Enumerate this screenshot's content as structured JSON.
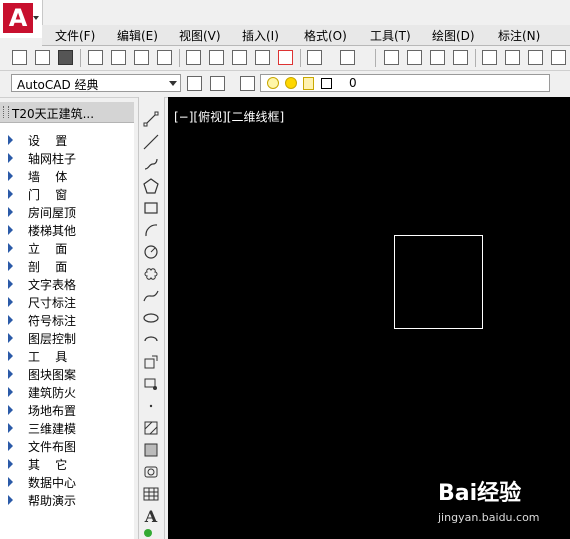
{
  "app": {
    "logo_letter": "A"
  },
  "menu": [
    {
      "label": "文件(F)"
    },
    {
      "label": "编辑(E)"
    },
    {
      "label": "视图(V)"
    },
    {
      "label": "插入(I)"
    },
    {
      "label": "格式(O)"
    },
    {
      "label": "工具(T)"
    },
    {
      "label": "绘图(D)"
    },
    {
      "label": "标注(N)"
    }
  ],
  "workspace": {
    "value": "AutoCAD 经典"
  },
  "layer": {
    "current_value": "0"
  },
  "panel": {
    "title": "T20天正建筑...",
    "items": [
      {
        "label": "设    置"
      },
      {
        "label": "轴网柱子"
      },
      {
        "label": "墙    体"
      },
      {
        "label": "门    窗"
      },
      {
        "label": "房间屋顶"
      },
      {
        "label": "楼梯其他"
      },
      {
        "label": "立    面"
      },
      {
        "label": "剖    面"
      },
      {
        "label": "文字表格"
      },
      {
        "label": "尺寸标注"
      },
      {
        "label": "符号标注"
      },
      {
        "label": "图层控制"
      },
      {
        "label": "工    具"
      },
      {
        "label": "图块图案"
      },
      {
        "label": "建筑防火"
      },
      {
        "label": "场地布置"
      },
      {
        "label": "三维建模"
      },
      {
        "label": "文件布图"
      },
      {
        "label": "其    它"
      },
      {
        "label": "数据中心"
      },
      {
        "label": "帮助演示"
      }
    ]
  },
  "canvas": {
    "view_label": "[−][俯视][二维线框]"
  },
  "watermark": {
    "brand": "Bai经验",
    "url": "jingyan.baidu.com"
  },
  "colors": {
    "canvas_bg": "#000000",
    "logo_red": "#c8102e",
    "tree_arrow": "#2b5aa8"
  }
}
